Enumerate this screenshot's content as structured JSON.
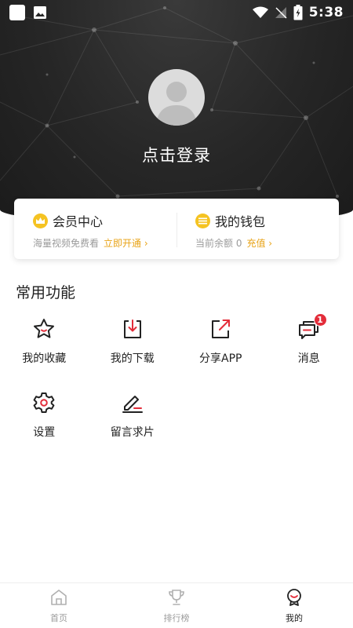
{
  "status_bar": {
    "time": "5:38"
  },
  "profile": {
    "login_text": "点击登录"
  },
  "card": {
    "membership": {
      "title": "会员中心",
      "subtitle": "海量视频免费看",
      "action": "立即开通"
    },
    "wallet": {
      "title": "我的钱包",
      "subtitle": "当前余额 0",
      "action": "充值"
    }
  },
  "functions": {
    "title": "常用功能",
    "items": [
      {
        "label": "我的收藏",
        "icon": "star-icon"
      },
      {
        "label": "我的下载",
        "icon": "download-icon"
      },
      {
        "label": "分享APP",
        "icon": "share-icon"
      },
      {
        "label": "消息",
        "icon": "message-icon",
        "badge": "1"
      },
      {
        "label": "设置",
        "icon": "gear-icon"
      },
      {
        "label": "留言求片",
        "icon": "edit-icon"
      }
    ]
  },
  "bottom_nav": {
    "items": [
      {
        "label": "首页",
        "icon": "home-icon"
      },
      {
        "label": "排行榜",
        "icon": "trophy-icon"
      },
      {
        "label": "我的",
        "icon": "profile-icon",
        "active": true
      }
    ]
  },
  "colors": {
    "accent": "#e8a317",
    "coin": "#f5c322",
    "icon_red": "#e32d3a",
    "header_dark": "#262626"
  }
}
